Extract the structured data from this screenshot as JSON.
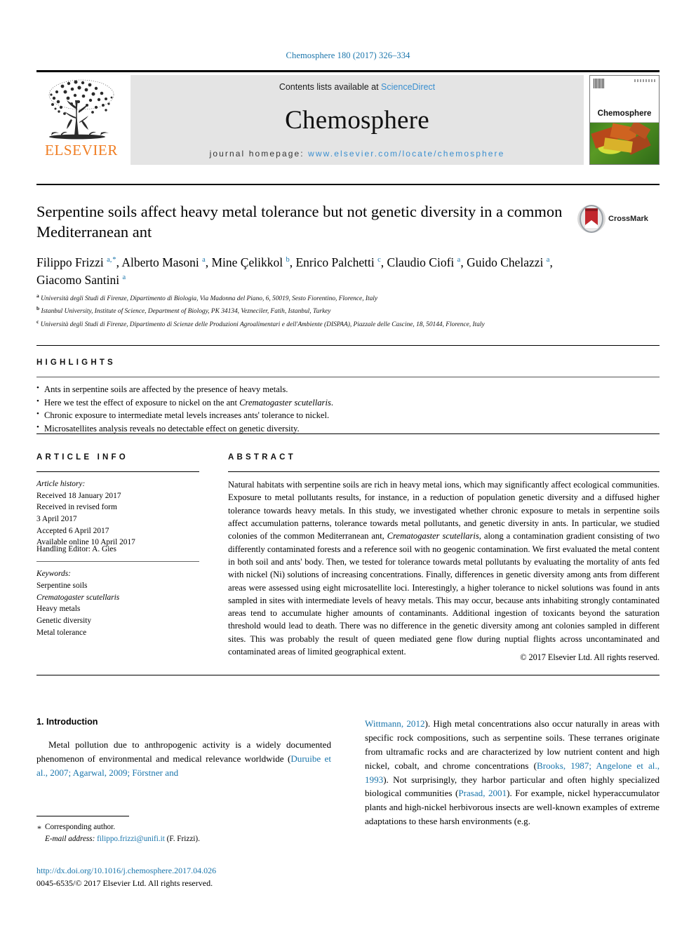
{
  "running_head": "Chemosphere 180 (2017) 326–334",
  "masthead": {
    "publisher": "ELSEVIER",
    "contents_prefix": "Contents lists available at ",
    "sciencedirect": "ScienceDirect",
    "journal_name": "Chemosphere",
    "homepage_prefix": "journal homepage: ",
    "homepage_url": "www.elsevier.com/locate/chemosphere",
    "cover_title": "Chemosphere"
  },
  "article": {
    "title": "Serpentine soils affect heavy metal tolerance but not genetic diversity in a common Mediterranean ant",
    "crossmark_label": "CrossMark",
    "authors_html": "Filippo Frizzi <sup>a,&#8202;*</sup>, Alberto Masoni <sup>a</sup>, Mine Çelikkol <sup>b</sup>, Enrico Palchetti <sup>c</sup>, Claudio Ciofi <sup>a</sup>, Guido Chelazzi <sup>a</sup>, Giacomo Santini <sup>a</sup>",
    "affiliations": [
      {
        "marker": "a",
        "text": "Università degli Studi di Firenze, Dipartimento di Biologia, Via Madonna del Piano, 6, 50019, Sesto Fiorentino, Florence, Italy"
      },
      {
        "marker": "b",
        "text": "Istanbul University, Institute of Science, Department of Biology, PK 34134, Vezneciler, Fatih, Istanbul, Turkey"
      },
      {
        "marker": "c",
        "text": "Università degli Studi di Firenze, Dipartimento di Scienze delle Produzioni Agroalimentari e dell'Ambiente (DISPAA), Piazzale delle Cascine, 18, 50144, Florence, Italy"
      }
    ]
  },
  "highlights": {
    "heading": "HIGHLIGHTS",
    "items_html": [
      "Ants in serpentine soils are affected by the presence of heavy metals.",
      "Here we test the effect of exposure to nickel on the ant <i>Crematogaster scutellaris</i>.",
      "Chronic exposure to intermediate metal levels increases ants' tolerance to nickel.",
      "Microsatellites analysis reveals no detectable effect on genetic diversity."
    ]
  },
  "article_info": {
    "heading": "ARTICLE INFO",
    "history_title": "Article history:",
    "history_lines": [
      "Received 18 January 2017",
      "Received in revised form",
      "3 April 2017",
      "Accepted 6 April 2017",
      "Available online 10 April 2017"
    ],
    "handling_editor": "Handling Editor: A. Gies",
    "keywords_title": "Keywords:",
    "keywords": [
      {
        "text": "Serpentine soils",
        "italic": false
      },
      {
        "text": "Crematogaster scutellaris",
        "italic": true
      },
      {
        "text": "Heavy metals",
        "italic": false
      },
      {
        "text": "Genetic diversity",
        "italic": false
      },
      {
        "text": "Metal tolerance",
        "italic": false
      }
    ]
  },
  "abstract": {
    "heading": "ABSTRACT",
    "body_html": "Natural habitats with serpentine soils are rich in heavy metal ions, which may significantly affect ecological communities. Exposure to metal pollutants results, for instance, in a reduction of population genetic diversity and a diffused higher tolerance towards heavy metals. In this study, we investigated whether chronic exposure to metals in serpentine soils affect accumulation patterns, tolerance towards metal pollutants, and genetic diversity in ants. In particular, we studied colonies of the common Mediterranean ant, <i>Crematogaster scutellaris</i>, along a contamination gradient consisting of two differently contaminated forests and a reference soil with no geogenic contamination. We first evaluated the metal content in both soil and ants' body. Then, we tested for tolerance towards metal pollutants by evaluating the mortality of ants fed with nickel (Ni) solutions of increasing concentrations. Finally, differences in genetic diversity among ants from different areas were assessed using eight microsatellite loci. Interestingly, a higher tolerance to nickel solutions was found in ants sampled in sites with intermediate levels of heavy metals. This may occur, because ants inhabiting strongly contaminated areas tend to accumulate higher amounts of contaminants. Additional ingestion of toxicants beyond the saturation threshold would lead to death. There was no difference in the genetic diversity among ant colonies sampled in different sites. This was probably the result of queen mediated gene flow during nuptial flights across uncontaminated and contaminated areas of limited geographical extent.",
    "copyright": "© 2017 Elsevier Ltd. All rights reserved."
  },
  "introduction": {
    "heading": "1. Introduction",
    "left_paragraph_html": "Metal pollution due to anthropogenic activity is a widely documented phenomenon of environmental and medical relevance worldwide (<span class=\"ref-link\">Duruibe et al., 2007; Agarwal, 2009; Förstner and</span>",
    "right_paragraph_html": "<span class=\"ref-link\">Wittmann, 2012</span>). High metal concentrations also occur naturally in areas with specific rock compositions, such as serpentine soils. These terranes originate from ultramafic rocks and are characterized by low nutrient content and high nickel, cobalt, and chrome concentrations (<span class=\"ref-link\">Brooks, 1987; Angelone et al., 1993</span>). Not surprisingly, they harbor particular and often highly specialized biological communities (<span class=\"ref-link\">Prasad, 2001</span>). For example, nickel hyperaccumulator plants and high-nickel herbivorous insects are well-known examples of extreme adaptations to these harsh environments (e.g."
  },
  "footer": {
    "corresponding_author": "Corresponding author.",
    "email_label": "E-mail address:",
    "email": "filippo.frizzi@unifi.it",
    "email_owner": "(F. Frizzi).",
    "doi": "http://dx.doi.org/10.1016/j.chemosphere.2017.04.026",
    "issn_line": "0045-6535/© 2017 Elsevier Ltd. All rights reserved."
  },
  "colors": {
    "link_blue": "#1a75ab",
    "sciencedirect_blue": "#3a8fd0",
    "elsevier_orange": "#f07d22",
    "band_gray": "#e4e4e4"
  }
}
